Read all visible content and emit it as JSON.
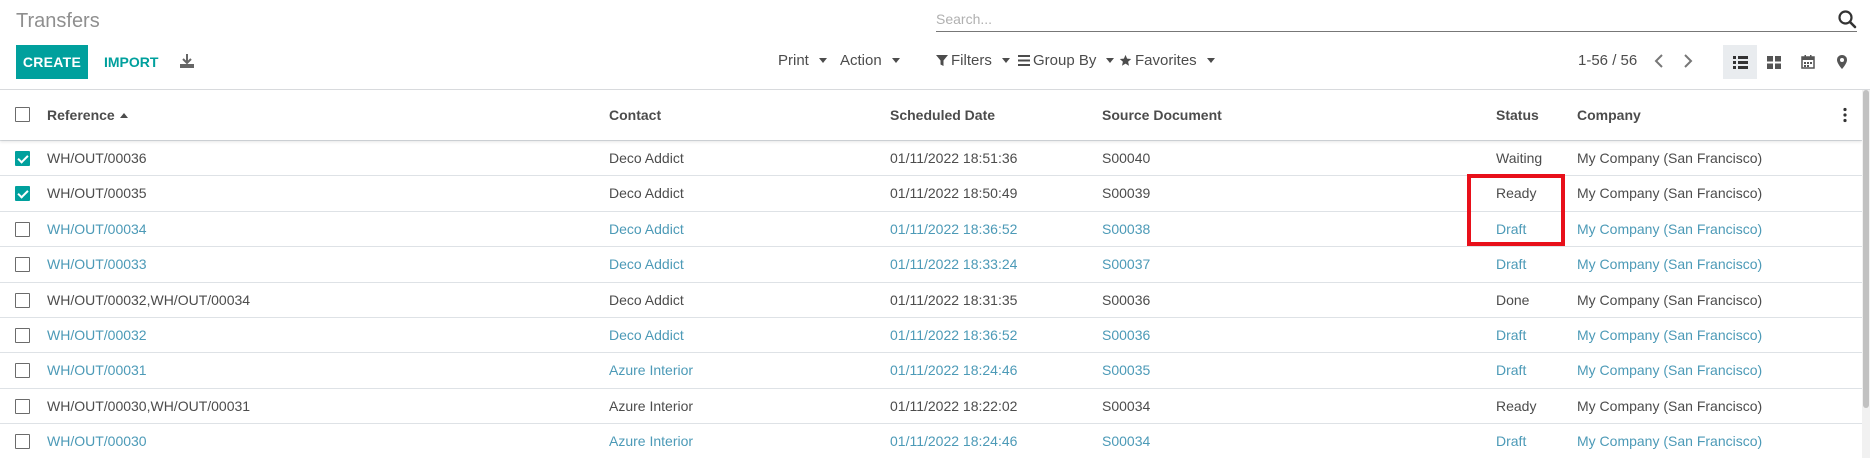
{
  "header": {
    "title": "Transfers",
    "search_placeholder": "Search...",
    "create_label": "CREATE",
    "import_label": "IMPORT",
    "print_label": "Print",
    "action_label": "Action",
    "filters_label": "Filters",
    "group_by_label": "Group By",
    "favorites_label": "Favorites",
    "pager_text": "1-56 / 56"
  },
  "columns": {
    "reference": "Reference",
    "contact": "Contact",
    "scheduled_date": "Scheduled Date",
    "source_document": "Source Document",
    "status": "Status",
    "company": "Company"
  },
  "rows": [
    {
      "reference": "WH/OUT/00036",
      "contact": "Deco Addict",
      "date": "01/11/2022 18:51:36",
      "source": "S00040",
      "status": "Waiting",
      "company": "My Company (San Francisco)",
      "checked": true,
      "muted": false
    },
    {
      "reference": "WH/OUT/00035",
      "contact": "Deco Addict",
      "date": "01/11/2022 18:50:49",
      "source": "S00039",
      "status": "Ready",
      "company": "My Company (San Francisco)",
      "checked": true,
      "muted": false
    },
    {
      "reference": "WH/OUT/00034",
      "contact": "Deco Addict",
      "date": "01/11/2022 18:36:52",
      "source": "S00038",
      "status": "Draft",
      "company": "My Company (San Francisco)",
      "checked": false,
      "muted": true
    },
    {
      "reference": "WH/OUT/00033",
      "contact": "Deco Addict",
      "date": "01/11/2022 18:33:24",
      "source": "S00037",
      "status": "Draft",
      "company": "My Company (San Francisco)",
      "checked": false,
      "muted": true
    },
    {
      "reference": "WH/OUT/00032,WH/OUT/00034",
      "contact": "Deco Addict",
      "date": "01/11/2022 18:31:35",
      "source": "S00036",
      "status": "Done",
      "company": "My Company (San Francisco)",
      "checked": false,
      "muted": false
    },
    {
      "reference": "WH/OUT/00032",
      "contact": "Deco Addict",
      "date": "01/11/2022 18:36:52",
      "source": "S00036",
      "status": "Draft",
      "company": "My Company (San Francisco)",
      "checked": false,
      "muted": true
    },
    {
      "reference": "WH/OUT/00031",
      "contact": "Azure Interior",
      "date": "01/11/2022 18:24:46",
      "source": "S00035",
      "status": "Draft",
      "company": "My Company (San Francisco)",
      "checked": false,
      "muted": true
    },
    {
      "reference": "WH/OUT/00030,WH/OUT/00031",
      "contact": "Azure Interior",
      "date": "01/11/2022 18:22:02",
      "source": "S00034",
      "status": "Ready",
      "company": "My Company (San Francisco)",
      "checked": false,
      "muted": false
    },
    {
      "reference": "WH/OUT/00030",
      "contact": "Azure Interior",
      "date": "01/11/2022 18:24:46",
      "source": "S00034",
      "status": "Draft",
      "company": "My Company (San Francisco)",
      "checked": false,
      "muted": true
    }
  ],
  "colors": {
    "accent": "#00a09d",
    "muted_link": "#4c9ab7",
    "highlight": "#e8101a"
  },
  "icons": [
    "search-icon",
    "download-icon",
    "filter-icon",
    "group-by-icon",
    "star-icon",
    "chevron-left-icon",
    "chevron-right-icon",
    "list-view-icon",
    "kanban-view-icon",
    "calendar-view-icon",
    "map-view-icon",
    "kebab-icon"
  ]
}
